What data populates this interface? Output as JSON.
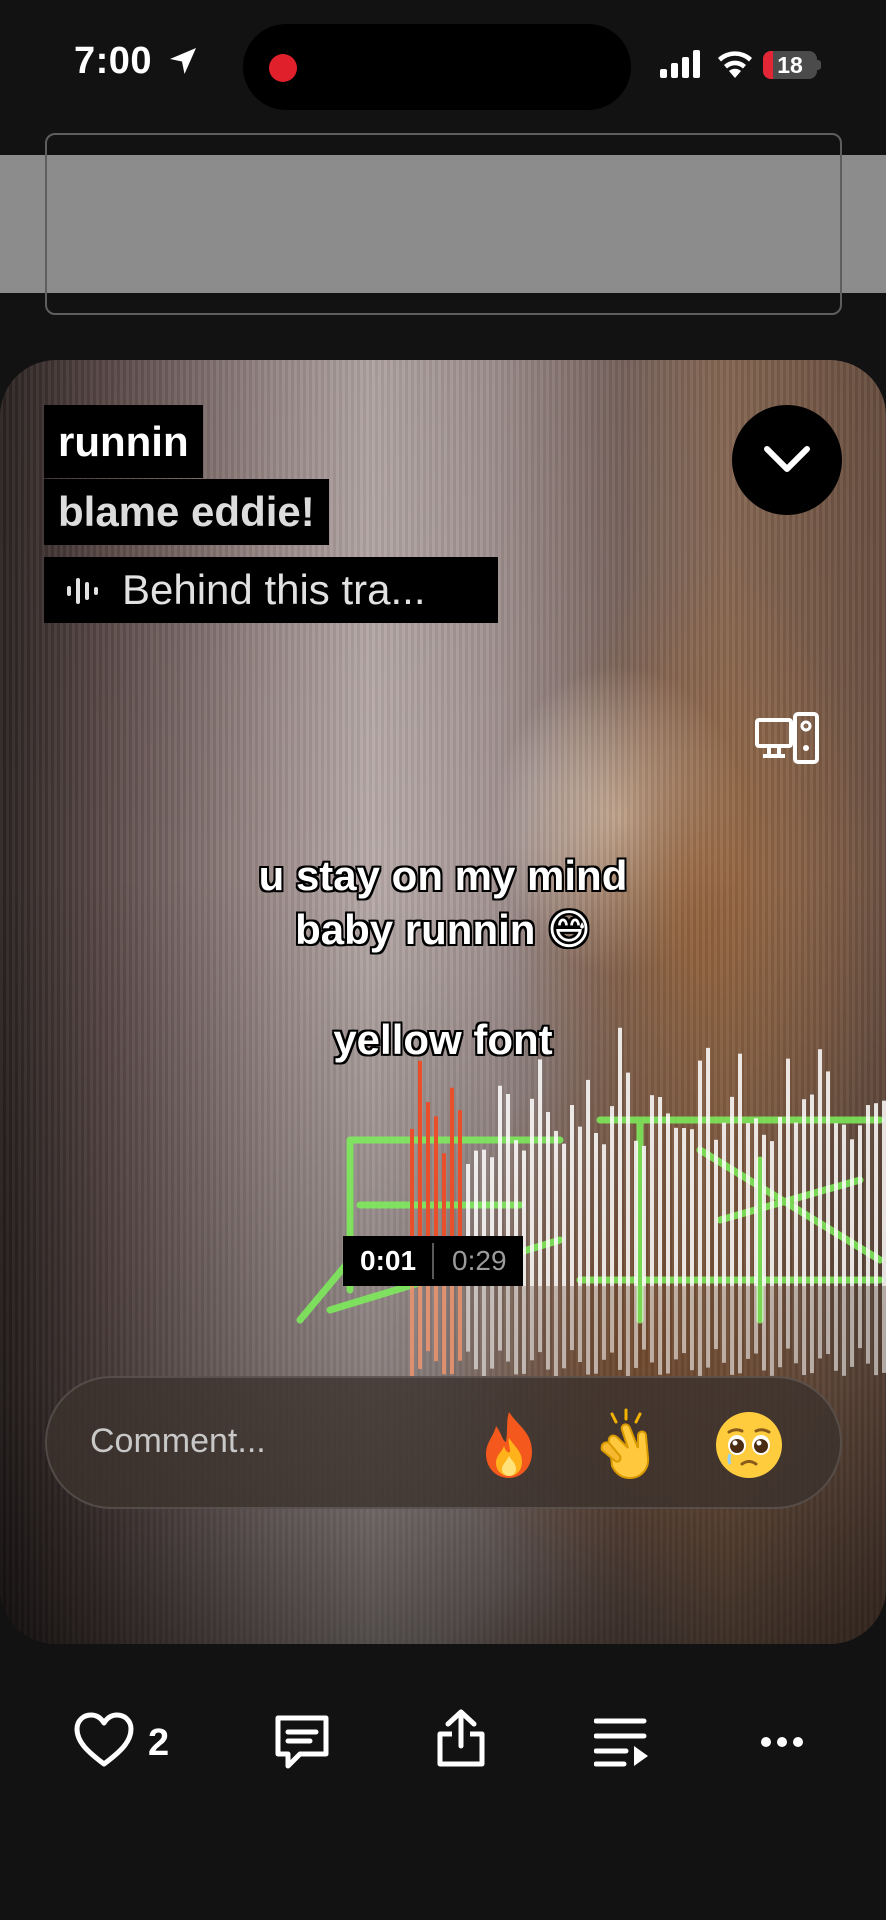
{
  "status_bar": {
    "time": "7:00",
    "battery_level": "18",
    "battery_color": "#e32635",
    "recording_color": "#e0202a",
    "icons": [
      "location-arrow-icon",
      "cellular-signal-icon",
      "wifi-icon",
      "battery-icon"
    ]
  },
  "track": {
    "title": "runnin",
    "artist": "blame eddie!",
    "behind_label": "Behind this tra..."
  },
  "lyrics": {
    "line_1": "u stay on my mind",
    "line_2": "baby runnin 😅",
    "line_3": "yellow font"
  },
  "player": {
    "current_time": "0:01",
    "duration": "0:29",
    "progress_fraction": 0.034,
    "played_color": "#e8502c"
  },
  "comment": {
    "placeholder": "Comment...",
    "reactions": [
      "🔥",
      "👏",
      "🥹"
    ]
  },
  "actions": {
    "like_count": "2",
    "icons": [
      "heart-icon",
      "comment-icon",
      "share-icon",
      "add-to-queue-icon",
      "more-icon"
    ]
  }
}
